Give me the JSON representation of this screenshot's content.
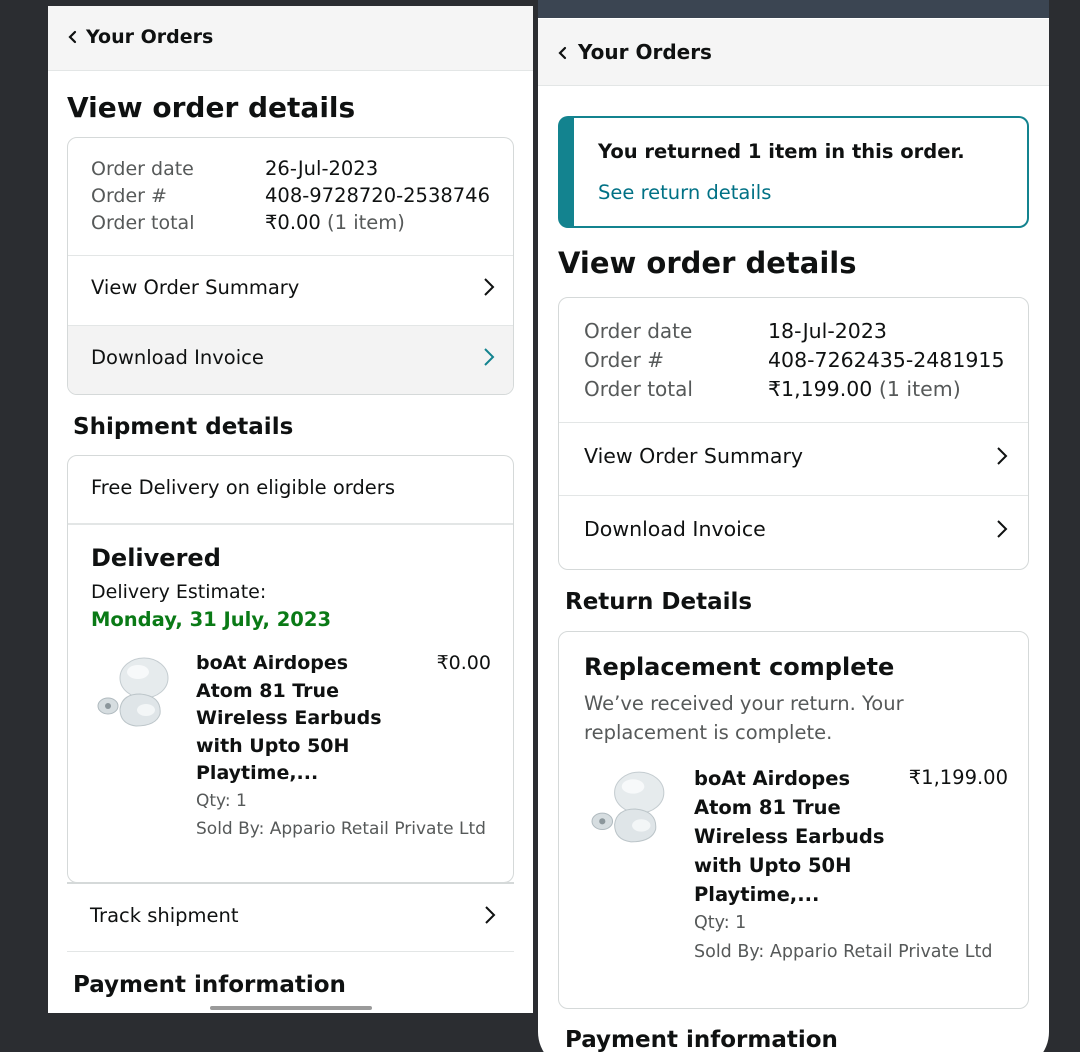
{
  "left": {
    "header_title": "Your Orders",
    "page_title": "View order details",
    "order": {
      "date_label": "Order date",
      "date_value": "26-Jul-2023",
      "number_label": "Order #",
      "number_value": "408-9728720-2538746",
      "total_label": "Order total",
      "total_value": "₹0.00",
      "total_items": "(1 item)"
    },
    "view_summary": "View Order Summary",
    "download_invoice": "Download Invoice",
    "shipment_heading": "Shipment details",
    "free_delivery": "Free Delivery on eligible orders",
    "status": "Delivered",
    "estimate_label": "Delivery Estimate:",
    "estimate_date": "Monday, 31 July, 2023",
    "product": {
      "title": "boAt Airdopes Atom 81 True Wireless Earbuds with Upto 50H Playtime,...",
      "price": "₹0.00",
      "qty": "Qty: 1",
      "seller": "Sold By: Appario Retail Private Ltd"
    },
    "track_shipment": "Track shipment",
    "payment_heading": "Payment information"
  },
  "right": {
    "header_title": "Your Orders",
    "return_notice": "You returned 1 item in this order.",
    "return_link": "See return details",
    "page_title": "View order details",
    "order": {
      "date_label": "Order date",
      "date_value": "18-Jul-2023",
      "number_label": "Order #",
      "number_value": "408-7262435-2481915",
      "total_label": "Order total",
      "total_value": "₹1,199.00",
      "total_items": "(1 item)"
    },
    "view_summary": "View Order Summary",
    "download_invoice": "Download Invoice",
    "return_heading": "Return Details",
    "replacement_title": "Replacement complete",
    "replacement_sub": "We’ve received your return. Your replacement is complete.",
    "product": {
      "title": "boAt Airdopes Atom 81 True Wireless Earbuds with Upto 50H Playtime,...",
      "price": "₹1,199.00",
      "qty": "Qty: 1",
      "seller": "Sold By: Appario Retail Private Ltd"
    },
    "payment_heading": "Payment information"
  },
  "colors": {
    "teal": "#13838f",
    "link": "#007185",
    "green": "#0a7a16"
  },
  "icons": {
    "back": "chevron-left-icon",
    "row": "chevron-right-icon",
    "product": "earbuds-product-image"
  }
}
